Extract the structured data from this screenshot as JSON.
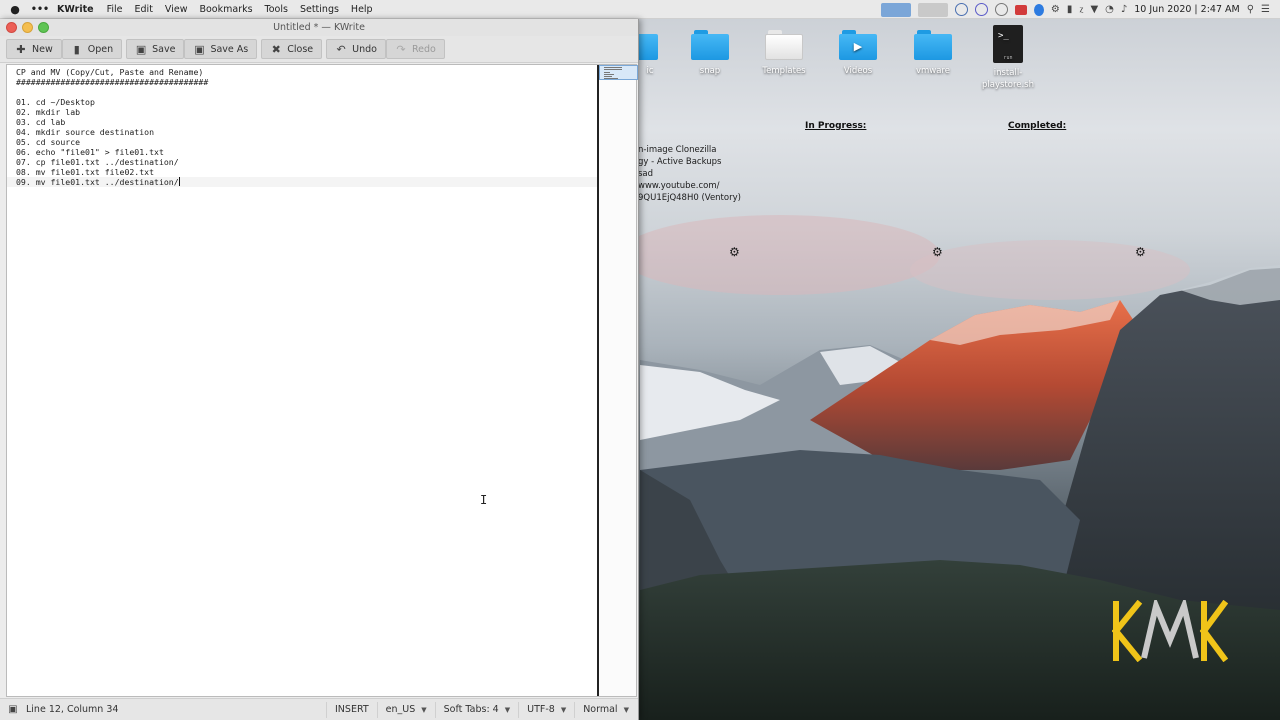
{
  "menubar": {
    "apple_icon": "apple-icon",
    "app_name": "KWrite",
    "items": [
      "File",
      "Edit",
      "View",
      "Bookmarks",
      "Tools",
      "Settings",
      "Help"
    ],
    "clock": "10 Jun 2020 | 2:47 AM"
  },
  "window": {
    "title": "Untitled * — KWrite",
    "toolbar": {
      "new": "New",
      "open": "Open",
      "save": "Save",
      "save_as": "Save As",
      "close": "Close",
      "undo": "Undo",
      "redo": "Redo"
    },
    "editor_lines": [
      "CP and MV (Copy/Cut, Paste and Rename)",
      "#######################################",
      "",
      "01. cd ~/Desktop",
      "02. mkdir lab",
      "03. cd lab",
      "04. mkdir source destination",
      "05. cd source",
      "06. echo \"file01\" > file01.txt",
      "07. cp file01.txt ../destination/",
      "08. mv file01.txt file02.txt",
      "09. mv file01.txt ../destination/"
    ],
    "status": {
      "position": "Line 12, Column 34",
      "mode": "INSERT",
      "language": "en_US",
      "tabs": "Soft Tabs: 4",
      "encoding": "UTF-8",
      "input_mode": "Normal"
    }
  },
  "desktop": {
    "icons": [
      {
        "label": "snap",
        "type": "folder"
      },
      {
        "label": "Templates",
        "type": "folder-white"
      },
      {
        "label": "Videos",
        "type": "folder-video"
      },
      {
        "label": "vmware",
        "type": "folder"
      },
      {
        "label": "install-playstore.sh",
        "type": "script"
      }
    ],
    "partial_icon_label": "ic",
    "script_tag": "run",
    "script_prompt": ">_",
    "widget": {
      "in_progress_label": "In Progress:",
      "completed_label": "Completed:",
      "lines": [
        "n-image Clonezilla",
        "gy - Active Backups",
        "sad",
        "www.youtube.com/",
        "9QU1EjQ48H0 (Ventory)"
      ]
    },
    "logo_text": "KMK"
  },
  "colors": {
    "folder_blue": "#1d98e2",
    "logo_yellow": "#f0c419",
    "logo_gray": "#bfbfbf"
  }
}
